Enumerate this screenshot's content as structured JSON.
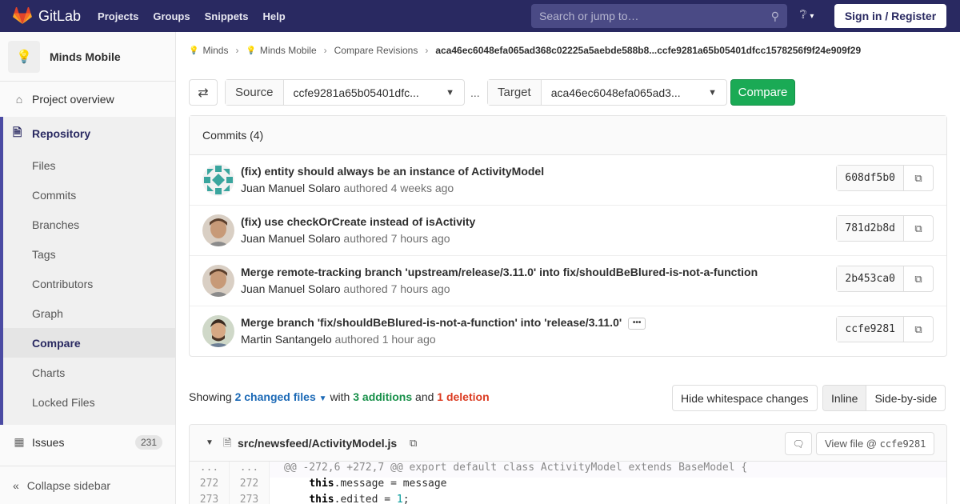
{
  "navbar": {
    "brand": "GitLab",
    "links": [
      "Projects",
      "Groups",
      "Snippets",
      "Help"
    ],
    "search_placeholder": "Search or jump to…",
    "signin": "Sign in / Register",
    "accent": "#292961"
  },
  "sidebar": {
    "project_name": "Minds Mobile",
    "overview": "Project overview",
    "repository": "Repository",
    "repo_items": [
      "Files",
      "Commits",
      "Branches",
      "Tags",
      "Contributors",
      "Graph",
      "Compare",
      "Charts",
      "Locked Files"
    ],
    "active_item": "Compare",
    "issues": "Issues",
    "issues_count": "231",
    "collapse": "Collapse sidebar"
  },
  "breadcrumb": {
    "items": [
      "Minds",
      "Minds Mobile",
      "Compare Revisions"
    ],
    "current": "aca46ec6048efa065ad368c02225a5aebde588b8...ccfe9281a65b05401dfcc1578256f9f24e909f29"
  },
  "compare": {
    "source_label": "Source",
    "source_value": "ccfe9281a65b05401dfc...",
    "dots": "...",
    "target_label": "Target",
    "target_value": "aca46ec6048efa065ad3...",
    "compare_button": "Compare"
  },
  "commits": {
    "header": "Commits (4)",
    "rows": [
      {
        "title": "(fix) entity should always be an instance of ActivityModel",
        "author": "Juan Manuel Solaro",
        "verb": "authored",
        "time": "4 weeks ago",
        "sha": "608df5b0"
      },
      {
        "title": "(fix) use checkOrCreate instead of isActivity",
        "author": "Juan Manuel Solaro",
        "verb": "authored",
        "time": "7 hours ago",
        "sha": "781d2b8d"
      },
      {
        "title": "Merge remote-tracking branch 'upstream/release/3.11.0' into fix/shouldBeBlured-is-not-a-function",
        "author": "Juan Manuel Solaro",
        "verb": "authored",
        "time": "7 hours ago",
        "sha": "2b453ca0"
      },
      {
        "title": "Merge branch 'fix/shouldBeBlured-is-not-a-function' into 'release/3.11.0'",
        "author": "Martin Santangelo",
        "verb": "authored",
        "time": "1 hour ago",
        "sha": "ccfe9281"
      }
    ]
  },
  "summary": {
    "showing": "Showing",
    "changed_files": "2 changed files",
    "with": "with",
    "additions": "3 additions",
    "and": "and",
    "deletions": "1 deletion",
    "hide_whitespace": "Hide whitespace changes",
    "inline": "Inline",
    "side_by_side": "Side-by-side"
  },
  "file": {
    "path": "src/newsfeed/ActivityModel.js",
    "view_file": "View file @",
    "view_sha": "ccfe9281",
    "lines": [
      {
        "old": "...",
        "new": "...",
        "text": "@@ -272,6 +272,7 @@ export default class ActivityModel extends BaseModel {"
      },
      {
        "old": "272",
        "new": "272",
        "kw": "this",
        "text": ".message = message"
      },
      {
        "old": "273",
        "new": "273",
        "kw": "this",
        "text": ".edited = ",
        "num": "1",
        "tail": ";"
      }
    ]
  }
}
